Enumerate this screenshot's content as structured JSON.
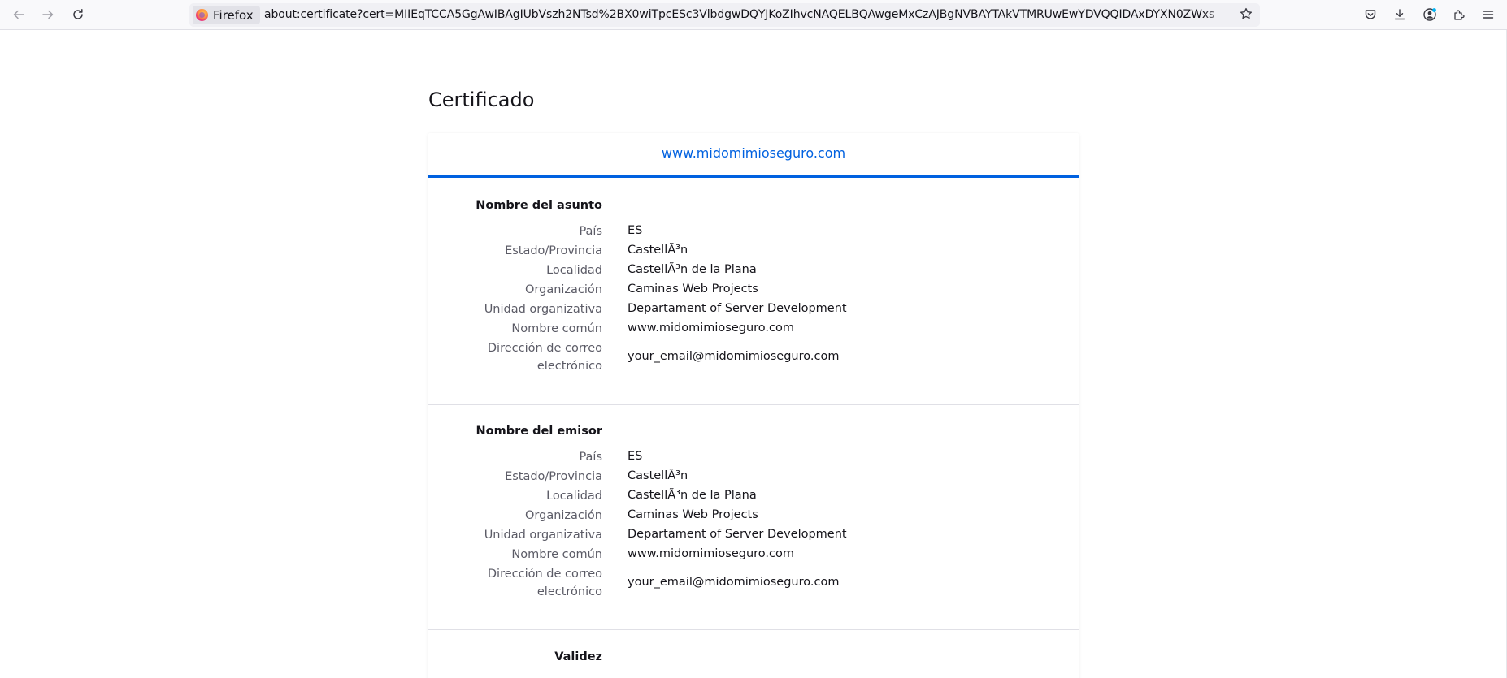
{
  "browser": {
    "identity_label": "Firefox",
    "url": "about:certificate?cert=MIIEqTCCA5GgAwIBAgIUbVszh2NTsd%2BX0wiTpcESc3VlbdgwDQYJKoZIhvcNAQELBQAwgeMxCzAJBgNVBAYTAkVTMRUwEwYDVQQIDAxDYXN0ZWxs",
    "icons": [
      "back-arrow-icon",
      "forward-arrow-icon",
      "reload-icon",
      "bookmark-star-icon",
      "pocket-icon",
      "downloads-icon",
      "account-icon",
      "extensions-icon",
      "menu-icon"
    ]
  },
  "page": {
    "title": "Certificado",
    "tab_label": "www.midomimioseguro.com",
    "accent_color": "#0061e0"
  },
  "subject": {
    "title": "Nombre del asunto",
    "rows": [
      {
        "label": "País",
        "value": "ES"
      },
      {
        "label": "Estado/Provincia",
        "value": "CastellÃ³n"
      },
      {
        "label": "Localidad",
        "value": "CastellÃ³n de la Plana"
      },
      {
        "label": "Organización",
        "value": "Caminas Web Projects"
      },
      {
        "label": "Unidad organizativa",
        "value": "Departament of Server Development"
      },
      {
        "label": "Nombre común",
        "value": "www.midomimioseguro.com"
      },
      {
        "label": "Dirección de correo electrónico",
        "value": "your_email@midomimioseguro.com"
      }
    ]
  },
  "issuer": {
    "title": "Nombre del emisor",
    "rows": [
      {
        "label": "País",
        "value": "ES"
      },
      {
        "label": "Estado/Provincia",
        "value": "CastellÃ³n"
      },
      {
        "label": "Localidad",
        "value": "CastellÃ³n de la Plana"
      },
      {
        "label": "Organización",
        "value": "Caminas Web Projects"
      },
      {
        "label": "Unidad organizativa",
        "value": "Departament of Server Development"
      },
      {
        "label": "Nombre común",
        "value": "www.midomimioseguro.com"
      },
      {
        "label": "Dirección de correo electrónico",
        "value": "your_email@midomimioseguro.com"
      }
    ]
  },
  "validity": {
    "title": "Validez"
  }
}
